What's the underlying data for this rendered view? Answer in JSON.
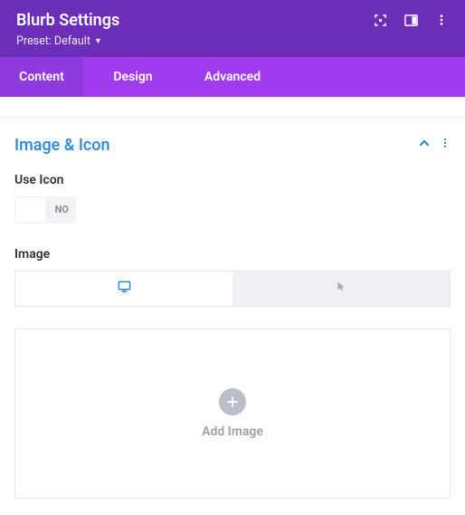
{
  "header": {
    "title": "Blurb Settings",
    "preset": "Preset: Default"
  },
  "tabs": [
    {
      "label": "Content",
      "active": true
    },
    {
      "label": "Design",
      "active": false
    },
    {
      "label": "Advanced",
      "active": false
    }
  ],
  "section": {
    "title": "Image & Icon"
  },
  "useIcon": {
    "label": "Use Icon",
    "state": "NO"
  },
  "image": {
    "label": "Image",
    "dropText": "Add Image"
  }
}
